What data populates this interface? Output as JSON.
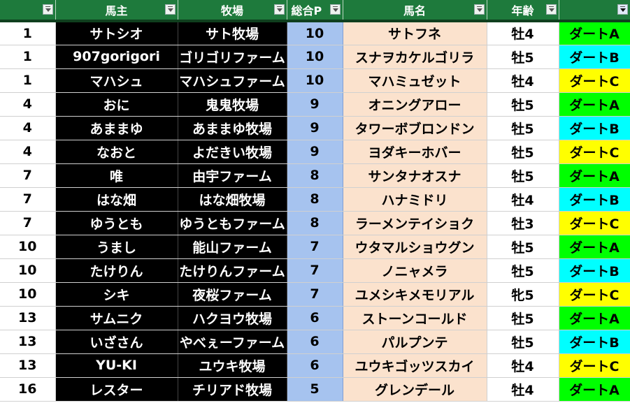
{
  "header": {
    "owner": "馬主",
    "farm": "牧場",
    "points": "総合P",
    "horse": "馬名",
    "age": "年齢"
  },
  "colors": {
    "header_green": "#1e7a3c",
    "points_blue": "#a6c3ef",
    "horse_peach": "#fbe2cd",
    "class_A": "#00ff00",
    "class_B": "#00ffff",
    "class_C": "#ffff00"
  },
  "rows": [
    {
      "rank": "1",
      "owner": "サトシオ",
      "farm": "サト牧場",
      "points": "10",
      "horse": "サトフネ",
      "age": "牡4",
      "class": "ダートA"
    },
    {
      "rank": "1",
      "owner": "907gorigori",
      "farm": "ゴリゴリファーム",
      "points": "10",
      "horse": "スナヲカケルゴリラ",
      "age": "牡5",
      "class": "ダートB"
    },
    {
      "rank": "1",
      "owner": "マハシュ",
      "farm": "マハシュファーム",
      "points": "10",
      "horse": "マハミュゼット",
      "age": "牡4",
      "class": "ダートC"
    },
    {
      "rank": "4",
      "owner": "おに",
      "farm": "鬼鬼牧場",
      "points": "9",
      "horse": "オニングアロー",
      "age": "牡5",
      "class": "ダートA"
    },
    {
      "rank": "4",
      "owner": "あままゆ",
      "farm": "あままゆ牧場",
      "points": "9",
      "horse": "タワーボブロンドン",
      "age": "牡5",
      "class": "ダートB"
    },
    {
      "rank": "4",
      "owner": "なおと",
      "farm": "よだきい牧場",
      "points": "9",
      "horse": "ヨダキーホバー",
      "age": "牡5",
      "class": "ダートC"
    },
    {
      "rank": "7",
      "owner": "唯",
      "farm": "由宇ファーム",
      "points": "8",
      "horse": "サンタナオスナ",
      "age": "牡5",
      "class": "ダートA"
    },
    {
      "rank": "7",
      "owner": "はな畑",
      "farm": "はな畑牧場",
      "points": "8",
      "horse": "ハナミドリ",
      "age": "牡4",
      "class": "ダートB"
    },
    {
      "rank": "7",
      "owner": "ゆうとも",
      "farm": "ゆうともファーム",
      "points": "8",
      "horse": "ラーメンテイショク",
      "age": "牡3",
      "class": "ダートC"
    },
    {
      "rank": "10",
      "owner": "うまし",
      "farm": "能山ファーム",
      "points": "7",
      "horse": "ウタマルショウグン",
      "age": "牡5",
      "class": "ダートA"
    },
    {
      "rank": "10",
      "owner": "たけりん",
      "farm": "たけりんファーム",
      "points": "7",
      "horse": "ノニャメラ",
      "age": "牡5",
      "class": "ダートB"
    },
    {
      "rank": "10",
      "owner": "シキ",
      "farm": "夜桜ファーム",
      "points": "7",
      "horse": "ユメシキメモリアル",
      "age": "牝5",
      "class": "ダートC"
    },
    {
      "rank": "13",
      "owner": "サムニク",
      "farm": "ハクヨウ牧場",
      "points": "6",
      "horse": "ストーンコールド",
      "age": "牡5",
      "class": "ダートA"
    },
    {
      "rank": "13",
      "owner": "いざさん",
      "farm": "やべぇーファーム",
      "points": "6",
      "horse": "パルプンテ",
      "age": "牡5",
      "class": "ダートB"
    },
    {
      "rank": "13",
      "owner": "YU-KI",
      "farm": "ユウキ牧場",
      "points": "6",
      "horse": "ユウキゴッツスカイ",
      "age": "牡4",
      "class": "ダートC"
    },
    {
      "rank": "16",
      "owner": "レスター",
      "farm": "チリアド牧場",
      "points": "5",
      "horse": "グレンデール",
      "age": "牡4",
      "class": "ダートA"
    }
  ]
}
